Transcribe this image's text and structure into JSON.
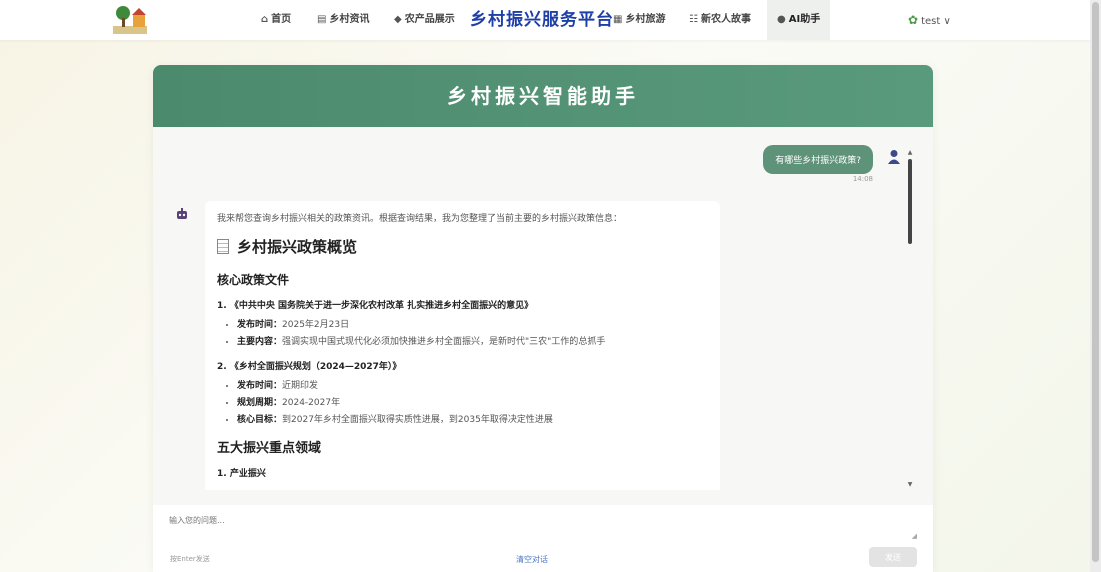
{
  "nav": {
    "items": [
      {
        "label": "首页",
        "icon": "home-icon"
      },
      {
        "label": "乡村资讯",
        "icon": "news-icon"
      },
      {
        "label": "农产品展示",
        "icon": "product-icon"
      },
      {
        "label": "乡村旅游",
        "icon": "travel-icon"
      },
      {
        "label": "新农人故事",
        "icon": "people-icon"
      },
      {
        "label": "AI助手",
        "icon": "robot-icon"
      }
    ],
    "brand": "乡村振兴服务平台",
    "username": "test",
    "active": "AI助手"
  },
  "chat": {
    "title": "乡村振兴智能助手",
    "user_message": "有哪些乡村振兴政策?",
    "user_time": "14:08",
    "bot": {
      "intro": "我来帮您查询乡村振兴相关的政策资讯。根据查询结果，我为您整理了当前主要的乡村振兴政策信息：",
      "heading": "乡村振兴政策概览",
      "section1": "核心政策文件",
      "policies": [
        {
          "title": "1. 《中共中央 国务院关于进一步深化农村改革 扎实推进乡村全面振兴的意见》",
          "details": [
            {
              "label": "发布时间",
              "value": "2025年2月23日"
            },
            {
              "label": "主要内容",
              "value": "强调实现中国式现代化必须加快推进乡村全面振兴，是新时代\"三农\"工作的总抓手"
            }
          ]
        },
        {
          "title": "2. 《乡村全面振兴规划（2024—2027年）》",
          "details": [
            {
              "label": "发布时间",
              "value": "近期印发"
            },
            {
              "label": "规划周期",
              "value": "2024-2027年"
            },
            {
              "label": "核心目标",
              "value": "到2027年乡村全面振兴取得实质性进展，到2035年取得决定性进展"
            }
          ]
        }
      ],
      "section2": "五大振兴重点领域",
      "section2_item": "产业振兴"
    }
  },
  "input": {
    "placeholder": "输入您的问题...",
    "hint": "按Enter发送",
    "clear_label": "清空对话",
    "send_label": "发送"
  },
  "colors": {
    "header": "#4c8a6e",
    "user_bubble": "#5f9379",
    "brand_text": "#1e3fa8"
  }
}
